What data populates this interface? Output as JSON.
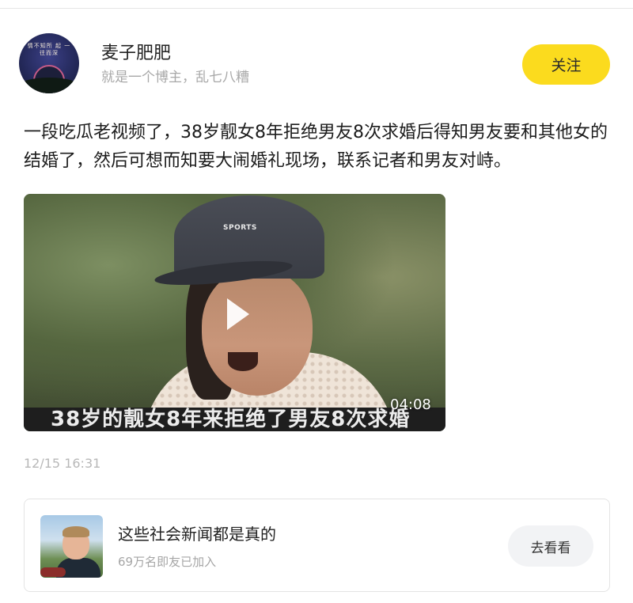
{
  "author": {
    "name": "麦子肥肥",
    "bio": "就是一个博主，乱七八糟",
    "avatar_text": "情不知所 起 一往而深",
    "follow_label": "关注",
    "follow_color": "#fbdb1e"
  },
  "post": {
    "text": "一段吃瓜老视频了，38岁靓女8年拒绝男友8次求婚后得知男友要和其他女的结婚了，然后可想而知要大闹婚礼现场，联系记者和男友对峙。",
    "timestamp": "12/15 16:31"
  },
  "video": {
    "duration": "04:08",
    "subtitle": "38岁的靓女8年来拒绝了男友8次求婚",
    "cap_logo": "SPORTS",
    "play_icon": "play-icon"
  },
  "group_card": {
    "title": "这些社会新闻都是真的",
    "subtitle": "69万名即友已加入",
    "button_label": "去看看"
  }
}
